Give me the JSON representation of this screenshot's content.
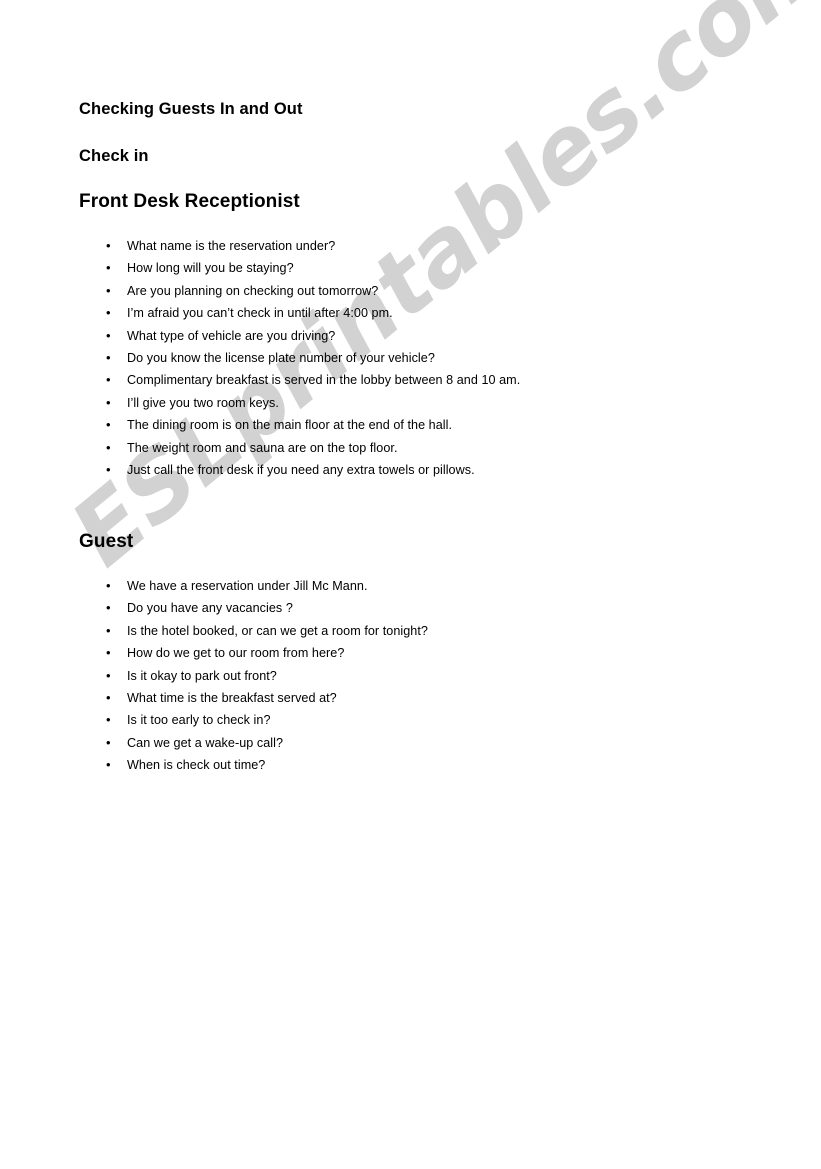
{
  "document": {
    "title": "Checking Guests In and Out",
    "section_check_in_label": "Check in",
    "watermark": "ESLprintables.com",
    "watermark_color": "#d2d2d2",
    "text_color": "#000000",
    "background_color": "#ffffff",
    "bullet_glyph": "•"
  },
  "sections": [
    {
      "heading": "Front Desk Receptionist",
      "items": [
        "What name is the reservation under?",
        "How long will you be staying?",
        "Are you planning on checking out tomorrow?",
        "I’m afraid you can’t check in until after 4:00 pm.",
        "What type of vehicle are you driving?",
        "Do you know the license plate number of your vehicle?",
        "Complimentary breakfast is served in the lobby between 8 and 10 am.",
        "I’ll give you two room keys.",
        "The dining room is on the main floor at the end of the hall.",
        "The weight room and sauna are on the top floor.",
        "Just call the front desk if you need any extra towels or pillows."
      ]
    },
    {
      "heading": "Guest",
      "items": [
        "We have a reservation under Jill Mc Mann.",
        "Do you have any vacancies ?",
        "Is the hotel booked, or can we get a room for tonight?",
        "How do we get to our room from here?",
        "Is it okay to park out front?",
        "What time is the breakfast served at?",
        "Is it too early to check in?",
        "Can we get  a wake-up call?",
        "When is check out time?"
      ]
    }
  ]
}
